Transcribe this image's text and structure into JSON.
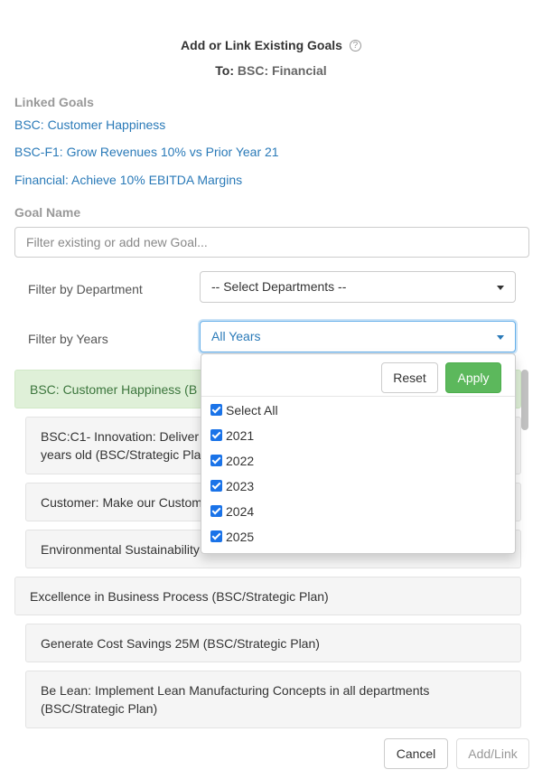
{
  "header": {
    "title": "Add or Link Existing Goals",
    "help_glyph": "?",
    "to_prefix": "To:",
    "to_target": "BSC: Financial"
  },
  "linked": {
    "label": "Linked Goals",
    "items": [
      "BSC: Customer Happiness",
      "BSC-F1: Grow Revenues 10% vs Prior Year 21",
      "Financial: Achieve 10% EBITDA Margins"
    ]
  },
  "goal_name": {
    "label": "Goal Name",
    "placeholder": "Filter existing or add new Goal...",
    "value": ""
  },
  "filters": {
    "department_label": "Filter by Department",
    "department_value": "-- Select Departments --",
    "years_label": "Filter by Years",
    "years_value": "All Years"
  },
  "years_dropdown": {
    "reset_label": "Reset",
    "apply_label": "Apply",
    "options": [
      {
        "label": "Select All",
        "checked": true
      },
      {
        "label": "2021",
        "checked": true
      },
      {
        "label": "2022",
        "checked": true
      },
      {
        "label": "2023",
        "checked": true
      },
      {
        "label": "2024",
        "checked": true
      },
      {
        "label": "2025",
        "checked": true
      }
    ]
  },
  "goal_list": [
    {
      "text": "BSC: Customer Happiness (B",
      "color": "#dff0d8"
    },
    {
      "text": "BSC:C1- Innovation: Deliver\nyears old (BSC/Strategic Pla"
    },
    {
      "text": "Customer: Make our Custom"
    },
    {
      "text": "Environmental Sustainability"
    },
    {
      "text": "Excellence in Business Process (BSC/Strategic Plan)"
    },
    {
      "text": "Generate Cost Savings 25M (BSC/Strategic Plan)"
    },
    {
      "text": "Be Lean: Implement Lean Manufacturing Concepts in all departments\n(BSC/Strategic Plan)"
    }
  ],
  "footer": {
    "cancel_label": "Cancel",
    "add_link_label": "Add/Link"
  },
  "colors": {
    "link": "#2a7ab8",
    "apply_green": "#5cb85c",
    "highlight_green": "#dff0d8",
    "checkbox_blue": "#1a73e8"
  }
}
